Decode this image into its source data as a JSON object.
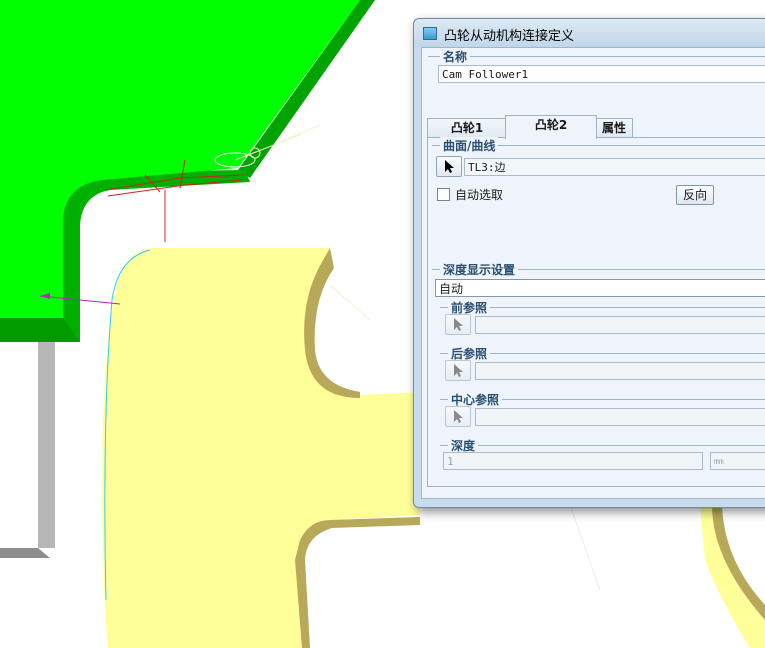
{
  "dialog": {
    "title": "凸轮从动机构连接定义",
    "name_group": {
      "label": "名称",
      "value": "Cam Follower1"
    },
    "tabs": [
      {
        "label": "凸轮1",
        "active": false
      },
      {
        "label": "凸轮2",
        "active": true
      },
      {
        "label": "属性",
        "active": false
      }
    ],
    "surface_group": {
      "label": "曲面/曲线",
      "value": "TL3:边"
    },
    "auto_select": {
      "label": "自动选取",
      "checked": false
    },
    "reverse_button": "反向",
    "depth_display": {
      "label": "深度显示设置",
      "value": "自动"
    },
    "front_ref": {
      "label": "前参照",
      "value": ""
    },
    "back_ref": {
      "label": "后参照",
      "value": ""
    },
    "center_ref": {
      "label": "中心参照",
      "value": ""
    },
    "depth": {
      "label": "深度",
      "value": "1",
      "unit": "mm"
    }
  },
  "colors": {
    "part_green": "#00ff00",
    "cam_yellow": "#ffff99",
    "dialog_frame": "#c9dcec",
    "group_label": "#2b4f73"
  }
}
